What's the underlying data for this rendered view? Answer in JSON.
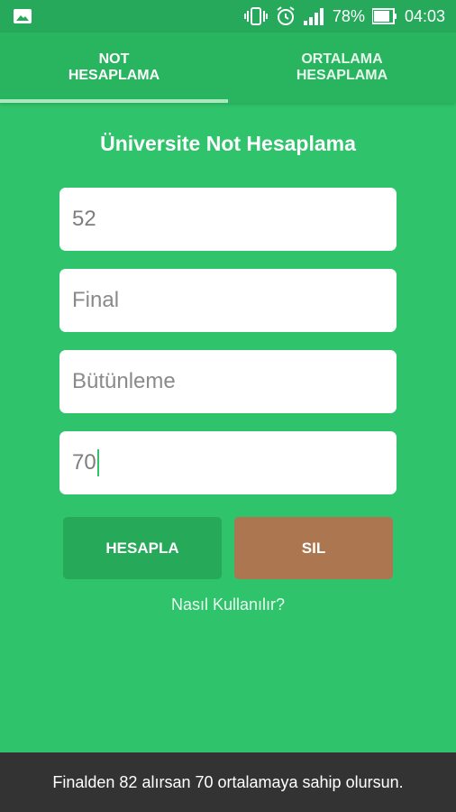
{
  "status_bar": {
    "battery_percent": "78%",
    "time": "04:03",
    "icons": [
      "gallery-icon",
      "vibrate-icon",
      "alarm-icon",
      "signal-icon",
      "battery-icon"
    ]
  },
  "tabs": [
    {
      "label": "NOT\nHESAPLAMA",
      "selected": true
    },
    {
      "label": "ORTALAMA\nHESAPLAMA",
      "selected": false
    }
  ],
  "page_title": "Üniversite Not Hesaplama",
  "fields": {
    "vize_value": "52",
    "final_placeholder": "Final",
    "butunleme_placeholder": "Bütünleme",
    "target_value": "70"
  },
  "buttons": {
    "calculate": "HESAPLA",
    "clear": "SIL"
  },
  "help_link": "Nasıl Kullanılır?",
  "toast": "Finalden 82 alırsan 70 ortalamaya sahip olursun.",
  "colors": {
    "background": "#2fc46b",
    "tab_bar": "#29b460",
    "calculate_button": "#27a95a",
    "clear_button": "#ac7650",
    "toast_bg": "#333333"
  }
}
